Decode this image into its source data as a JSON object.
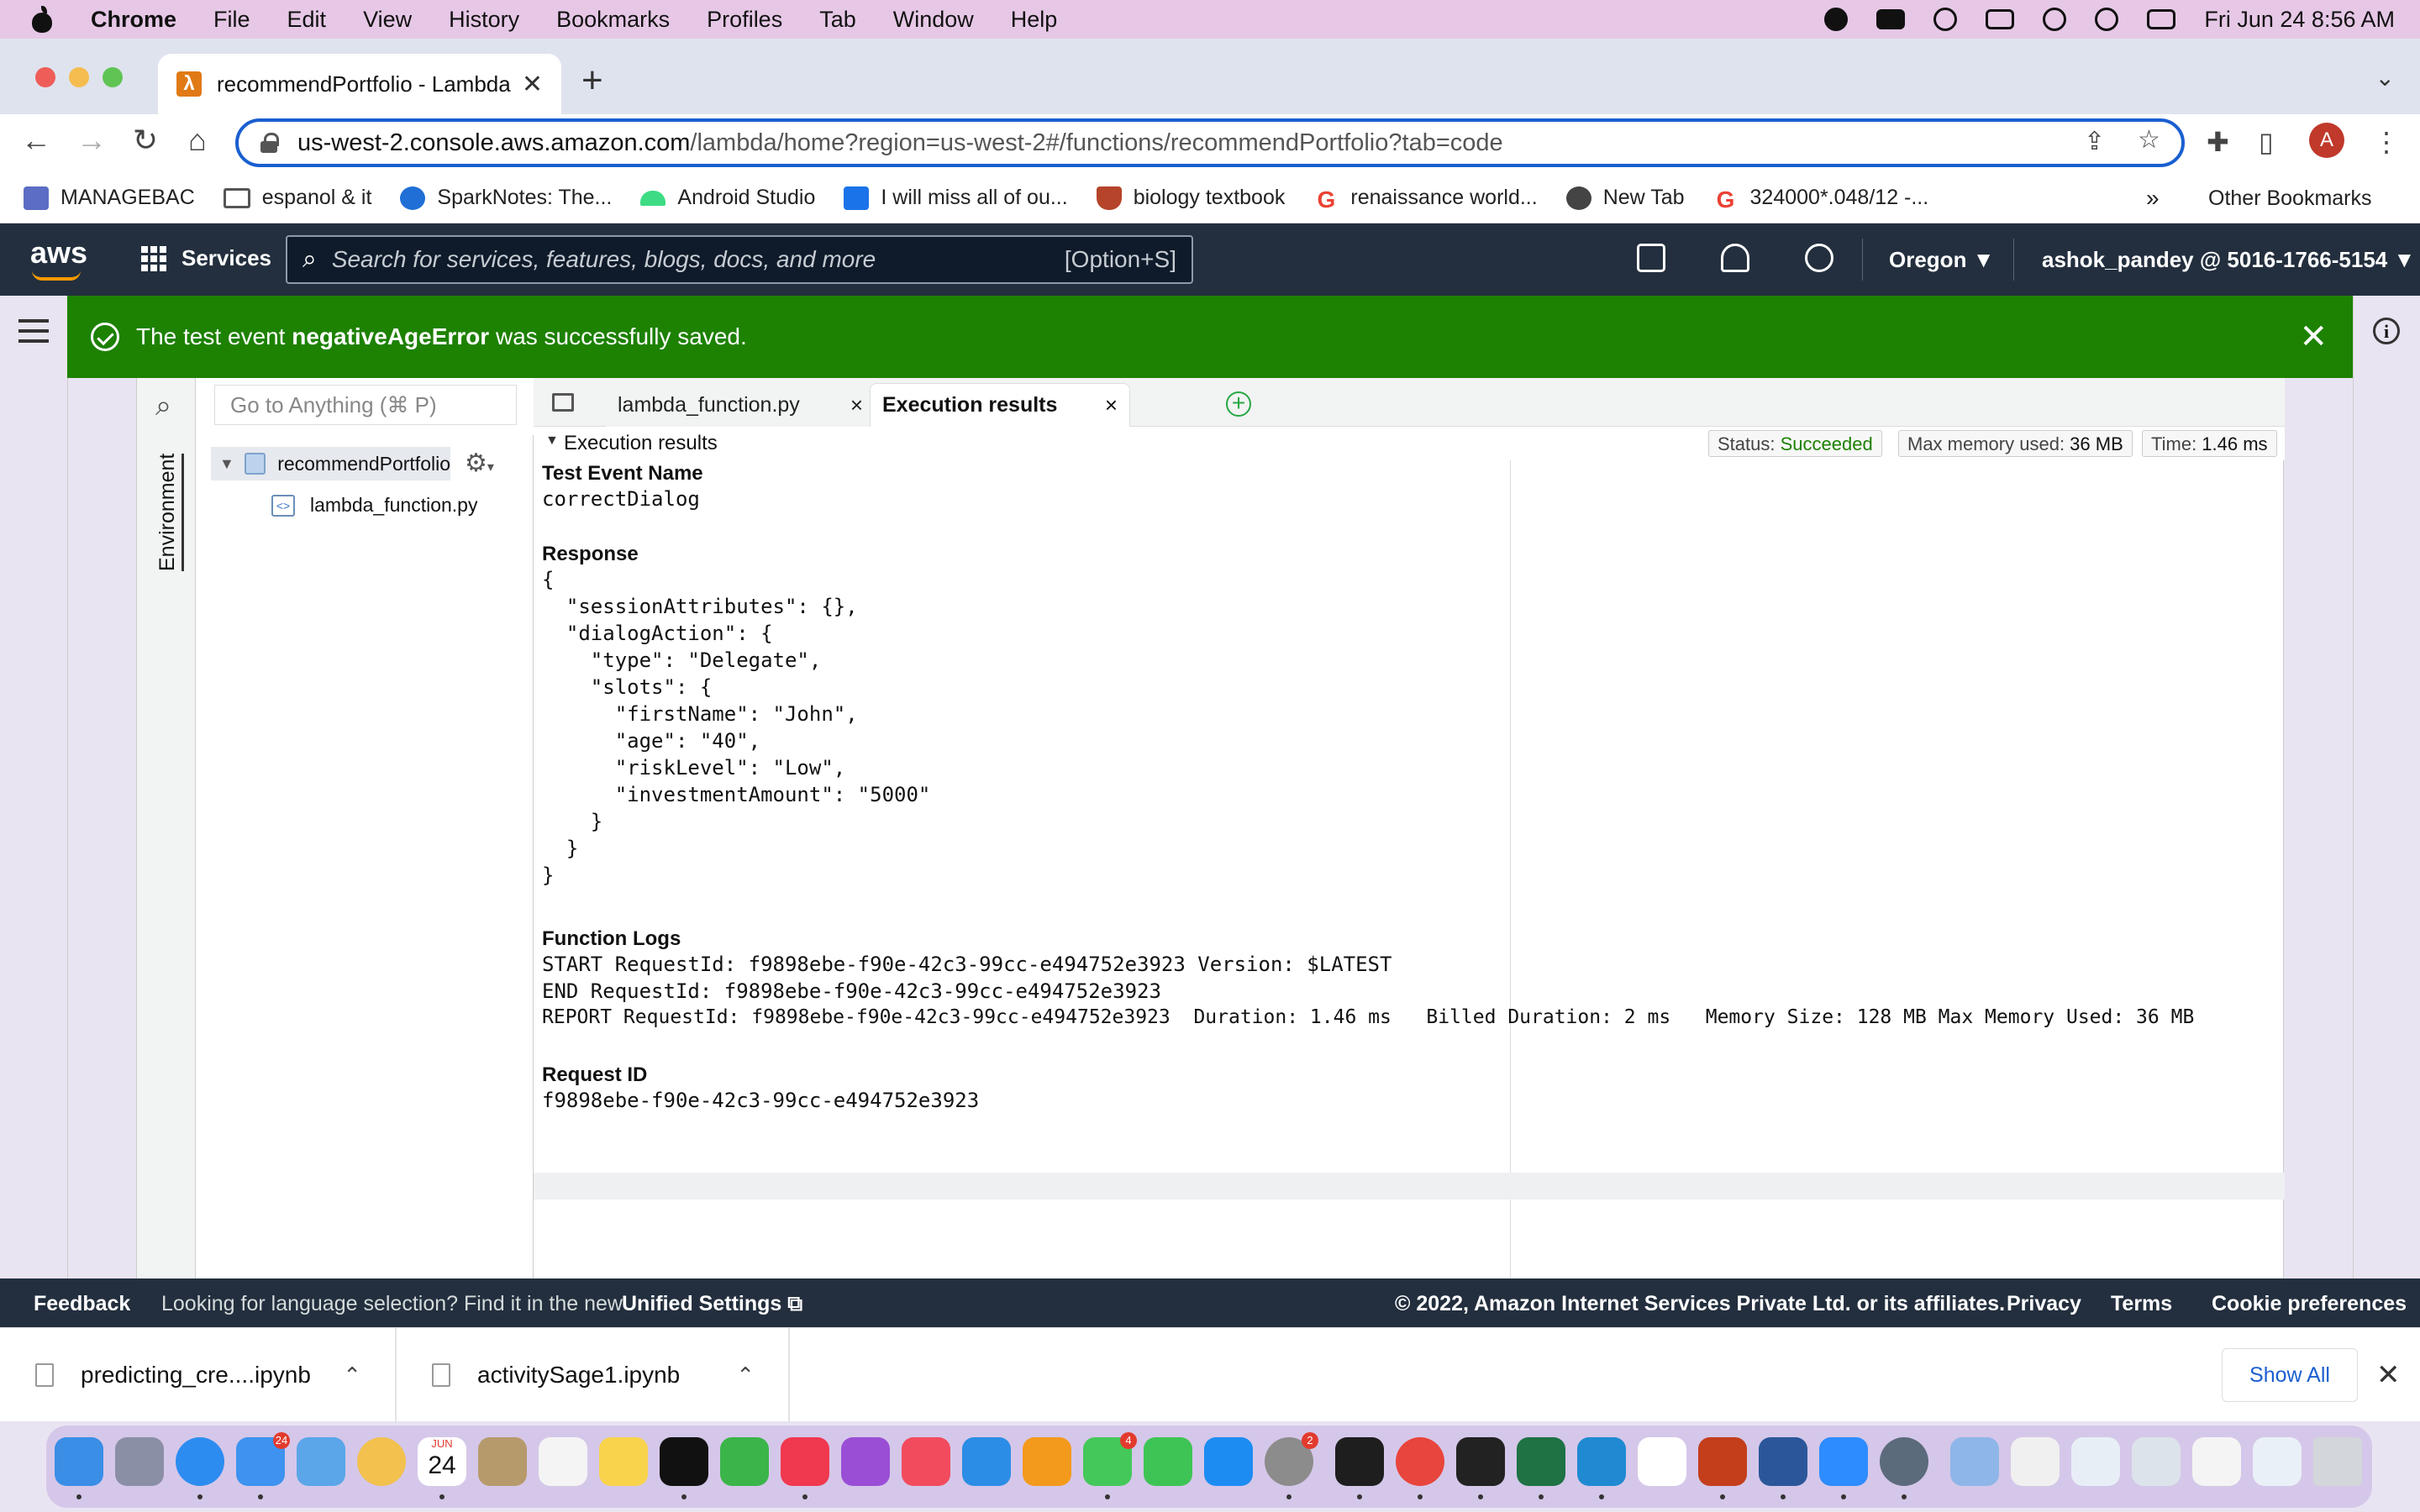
{
  "menubar": {
    "app": "Chrome",
    "items": [
      "File",
      "Edit",
      "View",
      "History",
      "Bookmarks",
      "Profiles",
      "Tab",
      "Window",
      "Help"
    ],
    "datetime": "Fri Jun 24  8:56 AM"
  },
  "browser": {
    "tab_title": "recommendPortfolio - Lambda",
    "url_host": "us-west-2.console.aws.amazon.com",
    "url_path": "/lambda/home?region=us-west-2#/functions/recommendPortfolio?tab=code",
    "avatar_letter": "A",
    "bookmarks": [
      {
        "label": "MANAGEBAC",
        "icon": "managebac-icon",
        "color": "#5b6dc4"
      },
      {
        "label": "espanol & it",
        "icon": "folder-icon",
        "color": "#555555"
      },
      {
        "label": "SparkNotes: The...",
        "icon": "sparknotes-icon",
        "color": "#1f6fd6"
      },
      {
        "label": "Android Studio",
        "icon": "android-icon",
        "color": "#3ddc84"
      },
      {
        "label": "I will miss all of ou...",
        "icon": "bookmark-blue-icon",
        "color": "#1a73e8"
      },
      {
        "label": "biology textbook",
        "icon": "shield-crest-icon",
        "color": "#b5442a"
      },
      {
        "label": "renaissance world...",
        "icon": "google-icon",
        "color": "#ea4335"
      },
      {
        "label": "New Tab",
        "icon": "globe-icon",
        "color": "#444444"
      },
      {
        "label": "324000*.048/12 -...",
        "icon": "google-icon",
        "color": "#ea4335"
      }
    ],
    "bookmarks_overflow": "»",
    "other_bookmarks": "Other Bookmarks"
  },
  "aws": {
    "logo": "aws",
    "services": "Services",
    "search_placeholder": "Search for services, features, blogs, docs, and more",
    "search_shortcut": "[Option+S]",
    "region": "Oregon",
    "account": "ashok_pandey @ 5016-1766-5154"
  },
  "banner": {
    "prefix": "The test event ",
    "event_name": "negativeAgeError",
    "suffix": " was successfully saved."
  },
  "ide": {
    "goto_placeholder": "Go to Anything (⌘ P)",
    "env_label": "Environment",
    "folder_name": "recommendPortfolio",
    "file_name": "lambda_function.py",
    "tabs": [
      {
        "label": "lambda_function.py",
        "active": false
      },
      {
        "label": "Execution results",
        "active": true
      }
    ],
    "results_title": "Execution results",
    "status_label": "Status: ",
    "status_value": "Succeeded",
    "memory_label": "Max memory used: ",
    "memory_value": "36 MB",
    "time_label": "Time: ",
    "time_value": "1.46 ms"
  },
  "results": {
    "test_event_label": "Test Event Name",
    "test_event_value": "correctDialog",
    "response_label": "Response",
    "response_lines": [
      "{",
      "  \"sessionAttributes\": {},",
      "  \"dialogAction\": {",
      "    \"type\": \"Delegate\",",
      "    \"slots\": {",
      "      \"firstName\": \"John\",",
      "      \"age\": \"40\",",
      "      \"riskLevel\": \"Low\",",
      "      \"investmentAmount\": \"5000\"",
      "    }",
      "  }",
      "}"
    ],
    "logs_label": "Function Logs",
    "log_lines": [
      "START RequestId: f9898ebe-f90e-42c3-99cc-e494752e3923 Version: $LATEST",
      "END RequestId: f9898ebe-f90e-42c3-99cc-e494752e3923",
      "REPORT RequestId: f9898ebe-f90e-42c3-99cc-e494752e3923  Duration: 1.46 ms   Billed Duration: 2 ms   Memory Size: 128 MB Max Memory Used: 36 MB"
    ],
    "request_id_label": "Request ID",
    "request_id_value": "f9898ebe-f90e-42c3-99cc-e494752e3923"
  },
  "footer": {
    "feedback": "Feedback",
    "language_text": "Looking for language selection? Find it in the new ",
    "unified_settings": "Unified Settings",
    "copyright": "© 2022, Amazon Internet Services Private Ltd. or its affiliates.",
    "privacy": "Privacy",
    "terms": "Terms",
    "cookies": "Cookie preferences"
  },
  "downloads": {
    "items": [
      "predicting_cre....ipynb",
      "activitySage1.ipynb"
    ],
    "show_all": "Show All"
  },
  "dock": {
    "calendar_month": "JUN",
    "calendar_day": "24",
    "mail_badge": "24",
    "messages_badge": "4",
    "settings_badge": "2"
  },
  "colors": {
    "aws_nav": "#232f3e",
    "success_banner": "#1d8102",
    "aws_orange": "#ff9900",
    "chrome_focus": "#1a5fd0"
  }
}
